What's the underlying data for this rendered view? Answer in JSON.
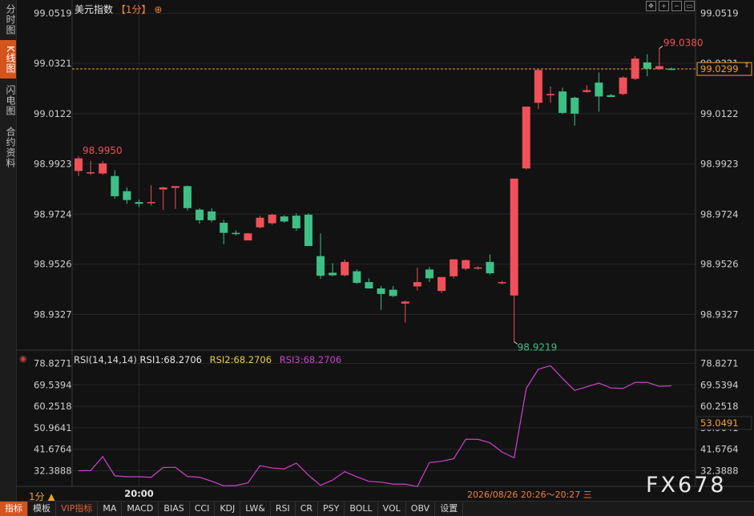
{
  "side_tabs": [
    "分时图",
    "K线图",
    "闪电图",
    "合约资料"
  ],
  "active_side_tab": 1,
  "header": {
    "title": "美元指数",
    "period": "【1分】",
    "add_icon": "⊕"
  },
  "rsi_legend": {
    "title": "RSI(14,14,14)",
    "items": [
      {
        "label": "RSI1:68.2706",
        "color": "#e8e8e8"
      },
      {
        "label": "RSI2:68.2706",
        "color": "#e8d040"
      },
      {
        "label": "RSI3:68.2706",
        "color": "#d040d0"
      }
    ]
  },
  "period_label": "1分 ▲",
  "timestamp": "2026/08/26 20:26～20:27 三",
  "watermark": "FX678",
  "bottom_tabs": [
    "指标",
    "模板",
    "VIP指标",
    "MA",
    "MACD",
    "BIAS",
    "CCI",
    "KDJ",
    "LW&",
    "RSI",
    "CR",
    "PSY",
    "BOLL",
    "VOL",
    "OBV",
    "设置"
  ],
  "colors": {
    "up": "#f0505a",
    "down": "#3dbf86",
    "rsi_line": "#d040d0",
    "accent": "#d4541d",
    "price_line": "#f0a030"
  },
  "chart_data": {
    "type": "candlestick",
    "instrument": "美元指数",
    "price_ticks": [
      99.0519,
      99.0321,
      99.0122,
      98.9923,
      98.9724,
      98.9526,
      98.9327
    ],
    "price_range": [
      98.9192,
      99.0572
    ],
    "current_price": "99.0299",
    "high_label": "99.0380",
    "low_label": "98.9219",
    "left_extreme_label": "98.9950",
    "x_tick_label": "20:00",
    "candles": [
      {
        "o": 98.9895,
        "h": 98.9955,
        "l": 98.9875,
        "c": 98.9945
      },
      {
        "o": 98.9888,
        "h": 98.9935,
        "l": 98.988,
        "c": 98.989
      },
      {
        "o": 98.9885,
        "h": 98.9935,
        "l": 98.988,
        "c": 98.9925
      },
      {
        "o": 98.9875,
        "h": 98.9898,
        "l": 98.9785,
        "c": 98.9795
      },
      {
        "o": 98.9815,
        "h": 98.983,
        "l": 98.9765,
        "c": 98.978
      },
      {
        "o": 98.9772,
        "h": 98.9782,
        "l": 98.9752,
        "c": 98.9765
      },
      {
        "o": 98.9768,
        "h": 98.9838,
        "l": 98.9758,
        "c": 98.9772
      },
      {
        "o": 98.9822,
        "h": 98.9832,
        "l": 98.974,
        "c": 98.983
      },
      {
        "o": 98.9828,
        "h": 98.9832,
        "l": 98.9745,
        "c": 98.9835
      },
      {
        "o": 98.9835,
        "h": 98.9838,
        "l": 98.9738,
        "c": 98.9748
      },
      {
        "o": 98.9742,
        "h": 98.9748,
        "l": 98.9686,
        "c": 98.97
      },
      {
        "o": 98.9735,
        "h": 98.9748,
        "l": 98.9692,
        "c": 98.97
      },
      {
        "o": 98.969,
        "h": 98.9702,
        "l": 98.9605,
        "c": 98.965
      },
      {
        "o": 98.965,
        "h": 98.966,
        "l": 98.964,
        "c": 98.9645
      },
      {
        "o": 98.962,
        "h": 98.965,
        "l": 98.962,
        "c": 98.9648
      },
      {
        "o": 98.9672,
        "h": 98.9718,
        "l": 98.9668,
        "c": 98.971
      },
      {
        "o": 98.9688,
        "h": 98.9725,
        "l": 98.9682,
        "c": 98.9722
      },
      {
        "o": 98.9715,
        "h": 98.972,
        "l": 98.969,
        "c": 98.9695
      },
      {
        "o": 98.9718,
        "h": 98.9728,
        "l": 98.9658,
        "c": 98.9668
      },
      {
        "o": 98.9722,
        "h": 98.9728,
        "l": 98.9598,
        "c": 98.9598
      },
      {
        "o": 98.9558,
        "h": 98.9648,
        "l": 98.9468,
        "c": 98.948
      },
      {
        "o": 98.9492,
        "h": 98.953,
        "l": 98.9478,
        "c": 98.9482
      },
      {
        "o": 98.9482,
        "h": 98.9545,
        "l": 98.9478,
        "c": 98.9535
      },
      {
        "o": 98.9498,
        "h": 98.9505,
        "l": 98.9448,
        "c": 98.9452
      },
      {
        "o": 98.9455,
        "h": 98.947,
        "l": 98.9448,
        "c": 98.943
      },
      {
        "o": 98.943,
        "h": 98.944,
        "l": 98.9345,
        "c": 98.9408
      },
      {
        "o": 98.9425,
        "h": 98.944,
        "l": 98.9395,
        "c": 98.94
      },
      {
        "o": 98.937,
        "h": 98.9382,
        "l": 98.9295,
        "c": 98.9378
      },
      {
        "o": 98.9438,
        "h": 98.9512,
        "l": 98.9422,
        "c": 98.9455
      },
      {
        "o": 98.9505,
        "h": 98.9515,
        "l": 98.9455,
        "c": 98.947
      },
      {
        "o": 98.942,
        "h": 98.9472,
        "l": 98.9412,
        "c": 98.9475
      },
      {
        "o": 98.9478,
        "h": 98.9545,
        "l": 98.947,
        "c": 98.9545
      },
      {
        "o": 98.9508,
        "h": 98.9545,
        "l": 98.9502,
        "c": 98.9542
      },
      {
        "o": 98.951,
        "h": 98.9518,
        "l": 98.9505,
        "c": 98.9513
      },
      {
        "o": 98.9535,
        "h": 98.9565,
        "l": 98.9485,
        "c": 98.949
      },
      {
        "o": 98.9452,
        "h": 98.946,
        "l": 98.9446,
        "c": 98.9455
      },
      {
        "o": 98.9402,
        "h": 98.9405,
        "l": 98.9218,
        "c": 98.9865
      },
      {
        "o": 98.9905,
        "h": 98.992,
        "l": 98.99,
        "c": 99.015
      },
      {
        "o": 99.0165,
        "h": 99.03,
        "l": 99.014,
        "c": 99.0295
      },
      {
        "o": 99.0195,
        "h": 99.023,
        "l": 99.0165,
        "c": 99.02
      },
      {
        "o": 99.021,
        "h": 99.0225,
        "l": 99.012,
        "c": 99.0125
      },
      {
        "o": 99.0185,
        "h": 99.019,
        "l": 99.0075,
        "c": 99.0122
      },
      {
        "o": 99.0208,
        "h": 99.0235,
        "l": 99.0205,
        "c": 99.0215
      },
      {
        "o": 99.0245,
        "h": 99.0285,
        "l": 99.013,
        "c": 99.019
      },
      {
        "o": 99.0195,
        "h": 99.02,
        "l": 99.019,
        "c": 99.0188
      },
      {
        "o": 99.02,
        "h": 99.027,
        "l": 99.0195,
        "c": 99.0265
      },
      {
        "o": 99.026,
        "h": 99.035,
        "l": 99.0255,
        "c": 99.034
      },
      {
        "o": 99.0325,
        "h": 99.0358,
        "l": 99.027,
        "c": 99.03
      },
      {
        "o": 99.0298,
        "h": 99.038,
        "l": 99.0295,
        "c": 99.031
      },
      {
        "o": 99.03,
        "h": 99.0305,
        "l": 99.0295,
        "c": 99.0299
      }
    ],
    "rsi_ticks": [
      78.8271,
      69.5394,
      60.2518,
      50.9641,
      41.6764,
      32.3888
    ],
    "rsi_range": [
      26.0,
      79.0
    ],
    "rsi_current": "53.0491",
    "rsi_values": [
      32.4,
      32.5,
      38.5,
      30.2,
      29.8,
      29.8,
      29.6,
      33.8,
      33.9,
      29.9,
      29.6,
      27.9,
      25.9,
      26.0,
      27.2,
      34.6,
      33.6,
      33.2,
      35.7,
      30.5,
      26.1,
      28.4,
      32.0,
      29.8,
      27.8,
      27.5,
      26.6,
      26.6,
      25.6,
      36.0,
      36.5,
      37.6,
      46.0,
      46.0,
      44.5,
      40.5,
      38.0,
      68.0,
      76.3,
      77.8,
      72.3,
      67.1,
      68.7,
      70.3,
      68.2,
      68.0,
      70.6,
      70.6,
      68.9,
      69.1
    ]
  }
}
